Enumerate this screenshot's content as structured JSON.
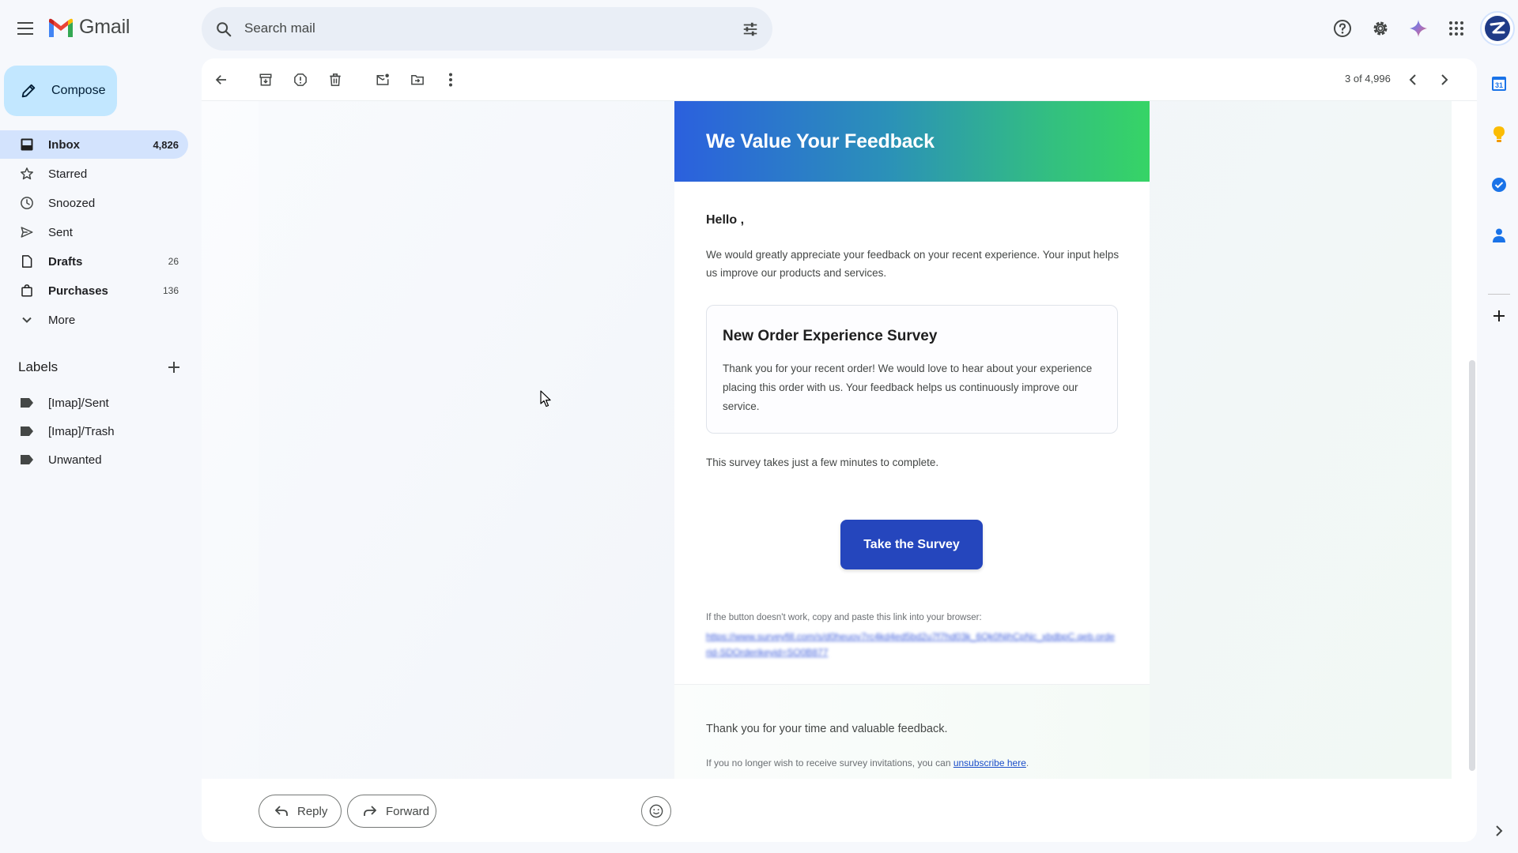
{
  "app": {
    "name": "Gmail"
  },
  "search": {
    "placeholder": "Search mail"
  },
  "compose": {
    "label": "Compose"
  },
  "nav": [
    {
      "label": "Inbox",
      "count": "4,826",
      "icon": "inbox-icon"
    },
    {
      "label": "Starred",
      "count": "",
      "icon": "star-icon"
    },
    {
      "label": "Snoozed",
      "count": "",
      "icon": "clock-icon"
    },
    {
      "label": "Sent",
      "count": "",
      "icon": "send-icon"
    },
    {
      "label": "Drafts",
      "count": "26",
      "icon": "draft-icon"
    },
    {
      "label": "Purchases",
      "count": "136",
      "icon": "bag-icon"
    },
    {
      "label": "More",
      "count": "",
      "icon": "chevron-down-icon"
    }
  ],
  "labels": {
    "title": "Labels",
    "items": [
      "[Imap]/Sent",
      "[Imap]/Trash",
      "Unwanted"
    ]
  },
  "toolbar": {
    "pager": "3 of 4,996"
  },
  "email": {
    "hero_title": "We Value Your Feedback",
    "greeting": "Hello ,",
    "intro": "We would greatly appreciate your feedback on your recent experience. Your input helps us improve our products and services.",
    "survey_title": "New Order Experience Survey",
    "survey_text": "Thank you for your recent order! We would love to hear about your experience placing this order with us. Your feedback helps us continuously improve our service.",
    "minutes_note": "This survey takes just a few minutes to complete.",
    "button_label": "Take the Survey",
    "fallback_note": "If the button doesn't work, copy and paste this link into your browser:",
    "fallback_link": "https://www.surveyfill.com/s/d0heuov7rc4kd4ed5bd2u7f7hd03k_6Qk0NjhCpNc_xbdbpC.qeb.orderid-SDOrderikeyid=SO0B877",
    "thanks": "Thank you for your time and valuable feedback.",
    "unsub_prefix": "If you no longer wish to receive survey invitations, you can ",
    "unsub_link": "unsubscribe here",
    "unsub_suffix": "."
  },
  "reply_bar": {
    "reply": "Reply",
    "forward": "Forward"
  },
  "side_panel": {
    "calendar_day": "31"
  },
  "colors": {
    "accent": "#0b57d0",
    "compose_bg": "#c2e7ff",
    "active_nav": "#d3e3fd",
    "survey_button": "#2546bd",
    "hero_gradient_start": "#2b60de",
    "hero_gradient_end": "#36d466"
  }
}
